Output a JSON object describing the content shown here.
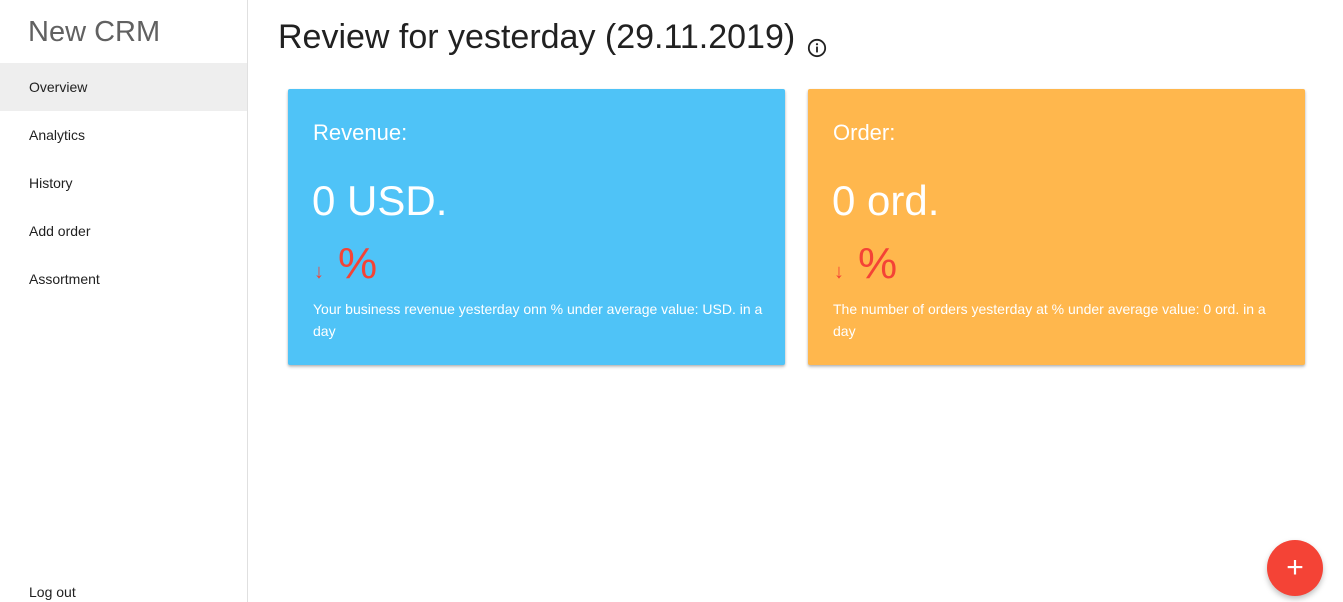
{
  "sidebar": {
    "brand": "New CRM",
    "items": [
      {
        "label": "Overview",
        "active": true
      },
      {
        "label": "Analytics",
        "active": false
      },
      {
        "label": "History",
        "active": false
      },
      {
        "label": "Add order",
        "active": false
      },
      {
        "label": "Assortment",
        "active": false
      }
    ],
    "logout_label": "Log out"
  },
  "header": {
    "title": "Review for yesterday (29.11.2019)",
    "info_icon": "info-circle-icon"
  },
  "cards": {
    "revenue": {
      "title": "Revenue:",
      "value": "0 USD.",
      "arrow": "↓",
      "percent": "%",
      "description": "Your business revenue yesterday onn % under average value: USD. in a day",
      "color": "#4fc3f7"
    },
    "orders": {
      "title": "Order:",
      "value": "0 ord.",
      "arrow": "↓",
      "percent": "%",
      "description": "The number of orders yesterday at % under average value: 0 ord. in a day",
      "color": "#ffb74d"
    },
    "delta_color": "#f44336"
  },
  "fab": {
    "label": "+",
    "icon": "plus-icon",
    "color": "#f44336"
  }
}
